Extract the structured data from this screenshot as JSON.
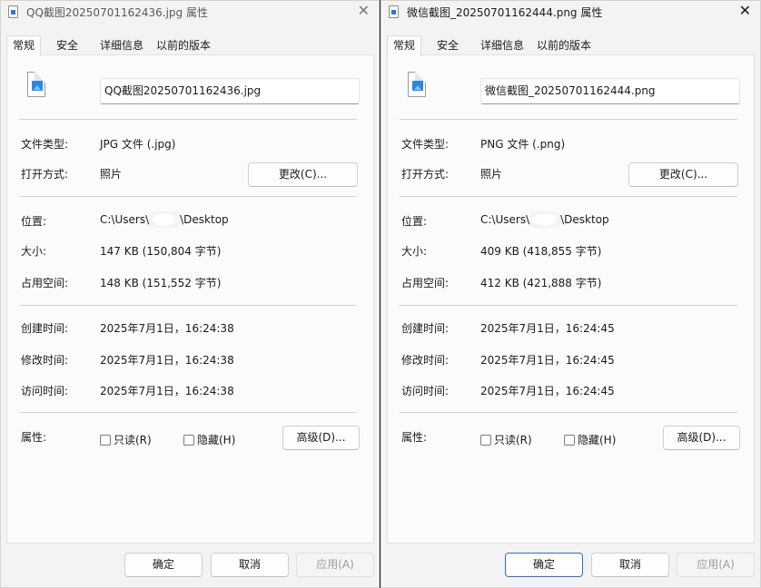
{
  "windows": [
    {
      "title": "QQ截图20250701162436.jpg 属性",
      "close_label": "✕",
      "tabs": [
        "常规",
        "安全",
        "详细信息",
        "以前的版本"
      ],
      "file_name": "QQ截图20250701162436.jpg",
      "file_type_label": "文件类型:",
      "file_type_value": "JPG 文件 (.jpg)",
      "open_with_label": "打开方式:",
      "open_with_value": "照片",
      "change_button": "更改(C)...",
      "location_label": "位置:",
      "location_prefix": "C:\\Users\\",
      "location_suffix": "\\Desktop",
      "size_label": "大小:",
      "size_value": "147 KB (150,804 字节)",
      "disk_size_label": "占用空间:",
      "disk_size_value": "148 KB (151,552 字节)",
      "created_label": "创建时间:",
      "created_value": "2025年7月1日，16:24:38",
      "modified_label": "修改时间:",
      "modified_value": "2025年7月1日，16:24:38",
      "accessed_label": "访问时间:",
      "accessed_value": "2025年7月1日，16:24:38",
      "attributes_label": "属性:",
      "readonly_label": "只读(R)",
      "hidden_label": "隐藏(H)",
      "advanced_button": "高级(D)...",
      "ok_button": "确定",
      "cancel_button": "取消",
      "apply_button": "应用(A)"
    },
    {
      "title": "微信截图_20250701162444.png 属性",
      "close_label": "✕",
      "tabs": [
        "常规",
        "安全",
        "详细信息",
        "以前的版本"
      ],
      "file_name": "微信截图_20250701162444.png",
      "file_type_label": "文件类型:",
      "file_type_value": "PNG 文件 (.png)",
      "open_with_label": "打开方式:",
      "open_with_value": "照片",
      "change_button": "更改(C)...",
      "location_label": "位置:",
      "location_prefix": "C:\\Users\\",
      "location_suffix": "\\Desktop",
      "size_label": "大小:",
      "size_value": "409 KB (418,855 字节)",
      "disk_size_label": "占用空间:",
      "disk_size_value": "412 KB (421,888 字节)",
      "created_label": "创建时间:",
      "created_value": "2025年7月1日，16:24:45",
      "modified_label": "修改时间:",
      "modified_value": "2025年7月1日，16:24:45",
      "accessed_label": "访问时间:",
      "accessed_value": "2025年7月1日，16:24:45",
      "attributes_label": "属性:",
      "readonly_label": "只读(R)",
      "hidden_label": "隐藏(H)",
      "advanced_button": "高级(D)...",
      "ok_button": "确定",
      "cancel_button": "取消",
      "apply_button": "应用(A)"
    }
  ],
  "colors": {
    "window_bg": "#f3f3f3",
    "panel_bg": "#fbfbfb",
    "default_button_border": "#2f70c8",
    "file_icon_blue": "#2b86e0"
  },
  "icons": {
    "title_icon": "image-file-icon",
    "file_icon": "image-file-icon",
    "close": "close-icon"
  }
}
